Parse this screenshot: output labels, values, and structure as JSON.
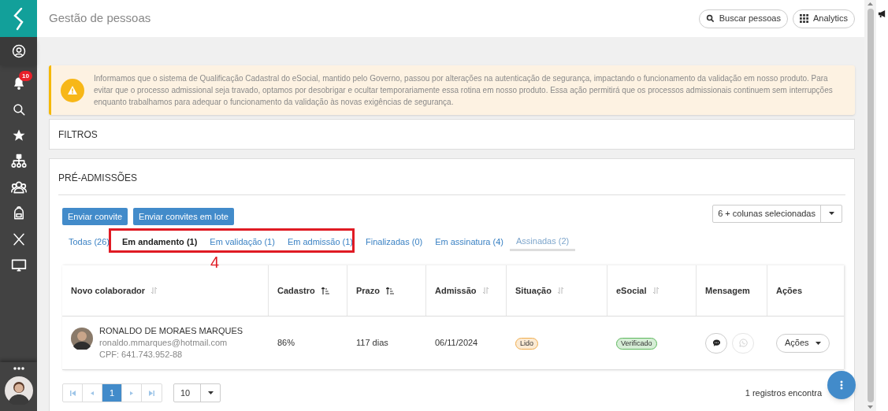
{
  "header": {
    "title": "Gestão de pessoas",
    "buttons": [
      {
        "kind": "search",
        "label": "Buscar pessoas"
      },
      {
        "kind": "grid",
        "label": "Analytics"
      }
    ]
  },
  "sidebar": {
    "items": [
      {
        "kind": "user",
        "selected": true
      },
      {
        "kind": "bell",
        "badge": "10",
        "selected": false
      },
      {
        "kind": "search",
        "selected": false
      },
      {
        "kind": "star",
        "selected": false
      },
      {
        "kind": "org",
        "selected": false
      },
      {
        "kind": "team",
        "selected": false
      },
      {
        "kind": "backpack",
        "selected": false
      },
      {
        "kind": "x",
        "selected": false
      },
      {
        "kind": "monitor",
        "selected": false
      }
    ]
  },
  "alert": {
    "text": "Informamos que o sistema de Qualificação Cadastral do eSocial, mantido pelo Governo, passou por alterações na autenticação de segurança, impactando o funcionamento da validação em nosso produto. Para evitar que o processo admissional seja travado, optamos por desobrigar e ocultar temporariamente essa rotina em nosso produto. Essa ação permitirá que os processos admissionais continuem sem interrupções enquanto trabalhamos para adequar o funcionamento da validação às novas exigências de segurança."
  },
  "filters": {
    "title": "FILTROS"
  },
  "pre_admissions": {
    "title": "PRÉ-ADMISSÕES",
    "buttons": [
      "Enviar convite",
      "Enviar convites em lote"
    ],
    "columns_select": "6 + colunas selecionadas",
    "tabs": [
      {
        "label": "Todas (26)",
        "selected": false,
        "highlighted": false
      },
      {
        "label": "Em andamento (1)",
        "selected": true,
        "highlighted": false
      },
      {
        "label": "Em validação (1)",
        "selected": false,
        "highlighted": false
      },
      {
        "label": "Em admissão (1)",
        "selected": false,
        "highlighted": false
      },
      {
        "label": "Finalizadas (0)",
        "selected": false,
        "highlighted": false
      },
      {
        "label": "Em assinatura (4)",
        "selected": false,
        "highlighted": false
      },
      {
        "label": "Assinadas (2)",
        "selected": false,
        "highlighted": true
      }
    ],
    "annotation": {
      "label": "4"
    },
    "table": {
      "columns": [
        {
          "label": "Novo colaborador",
          "sortable": true,
          "sorted": false
        },
        {
          "label": "Cadastro",
          "sortable": true,
          "sorted": true
        },
        {
          "label": "Prazo",
          "sortable": true,
          "sorted": true
        },
        {
          "label": "Admissão",
          "sortable": true,
          "sorted": false
        },
        {
          "label": "Situação",
          "sortable": true,
          "sorted": false
        },
        {
          "label": "eSocial",
          "sortable": true,
          "sorted": false
        },
        {
          "label": "Mensagem",
          "sortable": false
        },
        {
          "label": "Ações",
          "sortable": false
        }
      ],
      "rows": [
        {
          "name": "RONALDO DE MORAES MARQUES",
          "email": "ronaldo.mmarques@hotmail.com",
          "cpf": "CPF: 641.743.952-88",
          "cadastro": "86%",
          "prazo": "117 dias",
          "admissao": "06/11/2024",
          "situacao": {
            "label": "Lido",
            "color": "#f0ad4e"
          },
          "esocial": {
            "label": "Verificado",
            "color": "#5cb85c"
          },
          "messages": [
            {
              "kind": "chat",
              "disabled": false
            },
            {
              "kind": "whatsapp",
              "disabled": true
            }
          ],
          "actions": "Ações"
        }
      ]
    },
    "pagination": {
      "pages": [
        {
          "label": "1",
          "selected": true
        }
      ],
      "page_size": "10",
      "records": "1 registros encontra"
    }
  }
}
